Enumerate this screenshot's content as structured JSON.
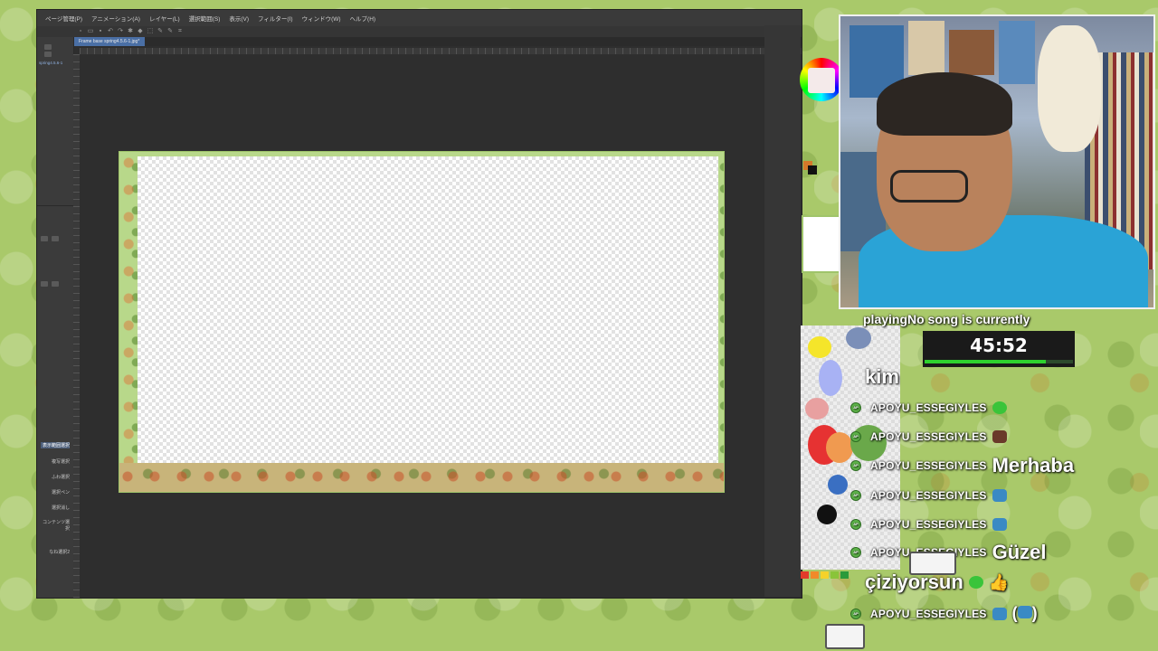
{
  "app": {
    "menu": [
      "ページ管理(P)",
      "アニメーション(A)",
      "レイヤー(L)",
      "選択範囲(S)",
      "表示(V)",
      "フィルター(I)",
      "ウィンドウ(W)",
      "ヘルプ(H)"
    ],
    "tab_label": "Frame base spring4.5.6-1.jpg*",
    "left_panel": {
      "tag": "spring4.5.6-1",
      "rows": [
        "表示範囲選択",
        "複写選択",
        "ふわ選択",
        "選択ペン",
        "選択消し",
        "コンテンツ選択",
        "なね選択2"
      ]
    }
  },
  "overlay": {
    "now_playing": "playingNo song is currently",
    "timer": {
      "text": "45:52",
      "progress": 0.82
    }
  },
  "chat": [
    {
      "user": "",
      "message": "kim",
      "emotes": []
    },
    {
      "user": "APOYU_ESSEGIYLES",
      "message": "",
      "emotes": [
        "green-blob"
      ]
    },
    {
      "user": "APOYU_ESSEGIYLES",
      "message": "",
      "emotes": [
        "face"
      ]
    },
    {
      "user": "APOYU_ESSEGIYLES",
      "message": "Merhaba",
      "emotes": []
    },
    {
      "user": "APOYU_ESSEGIYLES",
      "message": "",
      "emotes": [
        "frog"
      ]
    },
    {
      "user": "APOYU_ESSEGIYLES",
      "message": "",
      "emotes": [
        "frog"
      ]
    },
    {
      "user": "APOYU_ESSEGIYLES",
      "message": "Güzel",
      "emotes": []
    },
    {
      "user": "",
      "message": "çiziyorsun",
      "emotes": [
        "green-blob",
        "thumbs-up"
      ]
    },
    {
      "user": "APOYU_ESSEGIYLES",
      "message": "",
      "emotes": [
        "frog",
        "frog-in-parentheses"
      ]
    }
  ],
  "colors": {
    "accent_green": "#2ed12e",
    "chat_text": "#ffffff",
    "background_green": "#a9c96a"
  }
}
